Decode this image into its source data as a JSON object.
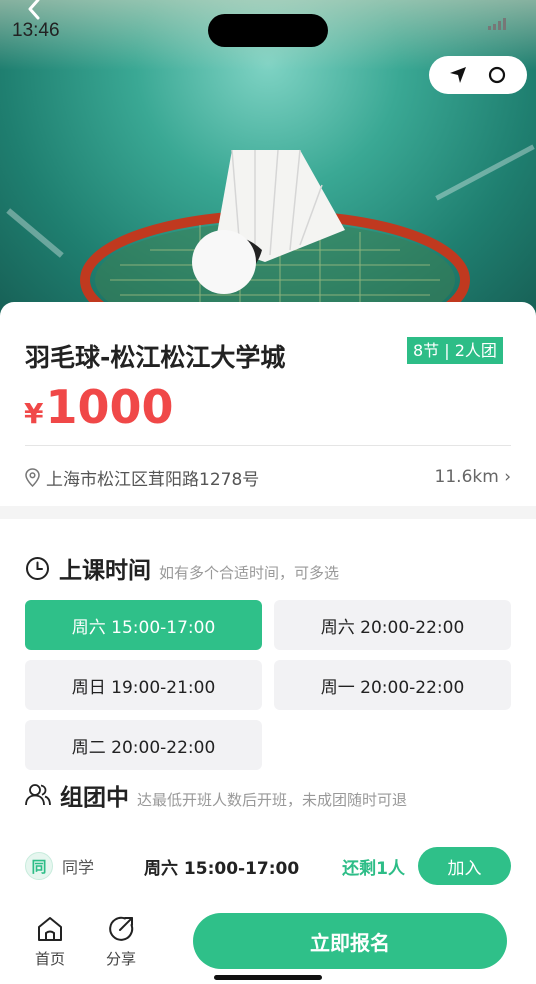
{
  "status_bar": {
    "time": "13:46"
  },
  "course": {
    "title": "羽毛球-松江松江大学城",
    "tag": "8节 | 2人团",
    "currency": "¥",
    "price": "1000",
    "address": "上海市松江区茸阳路1278号",
    "distance": "11.6km ›"
  },
  "schedule": {
    "heading": "上课时间",
    "hint": "如有多个合适时间，可多选",
    "slots": [
      {
        "label": "周六 15:00-17:00",
        "selected": true
      },
      {
        "label": "周六 20:00-22:00",
        "selected": false
      },
      {
        "label": "周日 19:00-21:00",
        "selected": false
      },
      {
        "label": "周一 20:00-22:00",
        "selected": false
      },
      {
        "label": "周二 20:00-22:00",
        "selected": false
      }
    ]
  },
  "group": {
    "heading": "组团中",
    "hint": "达最低开班人数后开班，未成团随时可退",
    "members": [
      {
        "avatar": "同",
        "role": "同学",
        "time": "周六 15:00-17:00",
        "remaining": "还剩1人",
        "action": "加入"
      }
    ]
  },
  "bottom_bar": {
    "home_label": "首页",
    "share_label": "分享",
    "signup_label": "立即报名"
  },
  "colors": {
    "accent": "#2fc089",
    "price": "#f04848"
  }
}
